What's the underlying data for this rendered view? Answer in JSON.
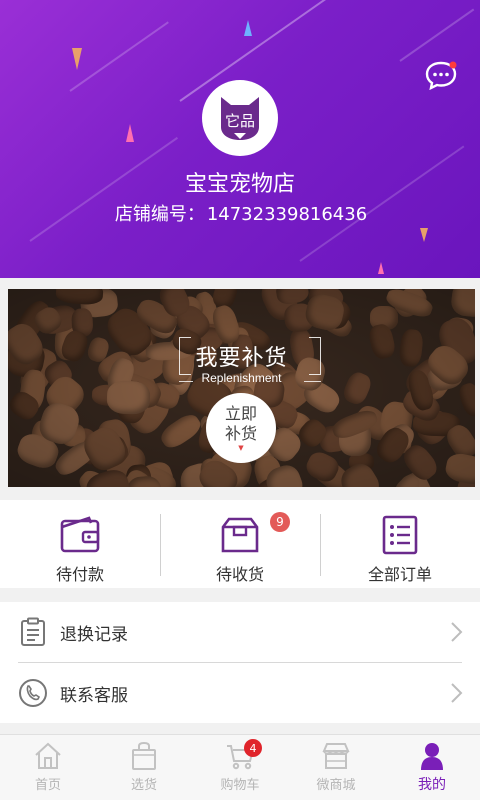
{
  "header": {
    "logo_text": "它品",
    "store_name": "宝宝宠物店",
    "store_id_label": "店铺编号：",
    "store_id": "14732339816436",
    "message_icon": "chat-bubble-icon",
    "colors": {
      "gradient_start": "#9a2fd6",
      "gradient_end": "#6a15bd"
    }
  },
  "banner": {
    "title": "我要补货",
    "subtitle": "Replenishment",
    "button_line1": "立即",
    "button_line2": "补货"
  },
  "orders": [
    {
      "label": "待付款",
      "icon": "wallet-icon"
    },
    {
      "label": "待收货",
      "icon": "package-icon",
      "badge": "9"
    },
    {
      "label": "全部订单",
      "icon": "order-list-icon"
    }
  ],
  "list": [
    {
      "label": "退换记录",
      "icon": "clipboard-icon"
    },
    {
      "label": "联系客服",
      "icon": "phone-icon"
    }
  ],
  "tabbar": {
    "items": [
      {
        "label": "首页",
        "icon": "home-icon"
      },
      {
        "label": "选货",
        "icon": "bag-icon"
      },
      {
        "label": "购物车",
        "icon": "cart-icon",
        "badge": "4"
      },
      {
        "label": "微商城",
        "icon": "store-icon"
      },
      {
        "label": "我的",
        "icon": "user-icon",
        "active": true
      }
    ],
    "accent": "#7a1fb8"
  }
}
